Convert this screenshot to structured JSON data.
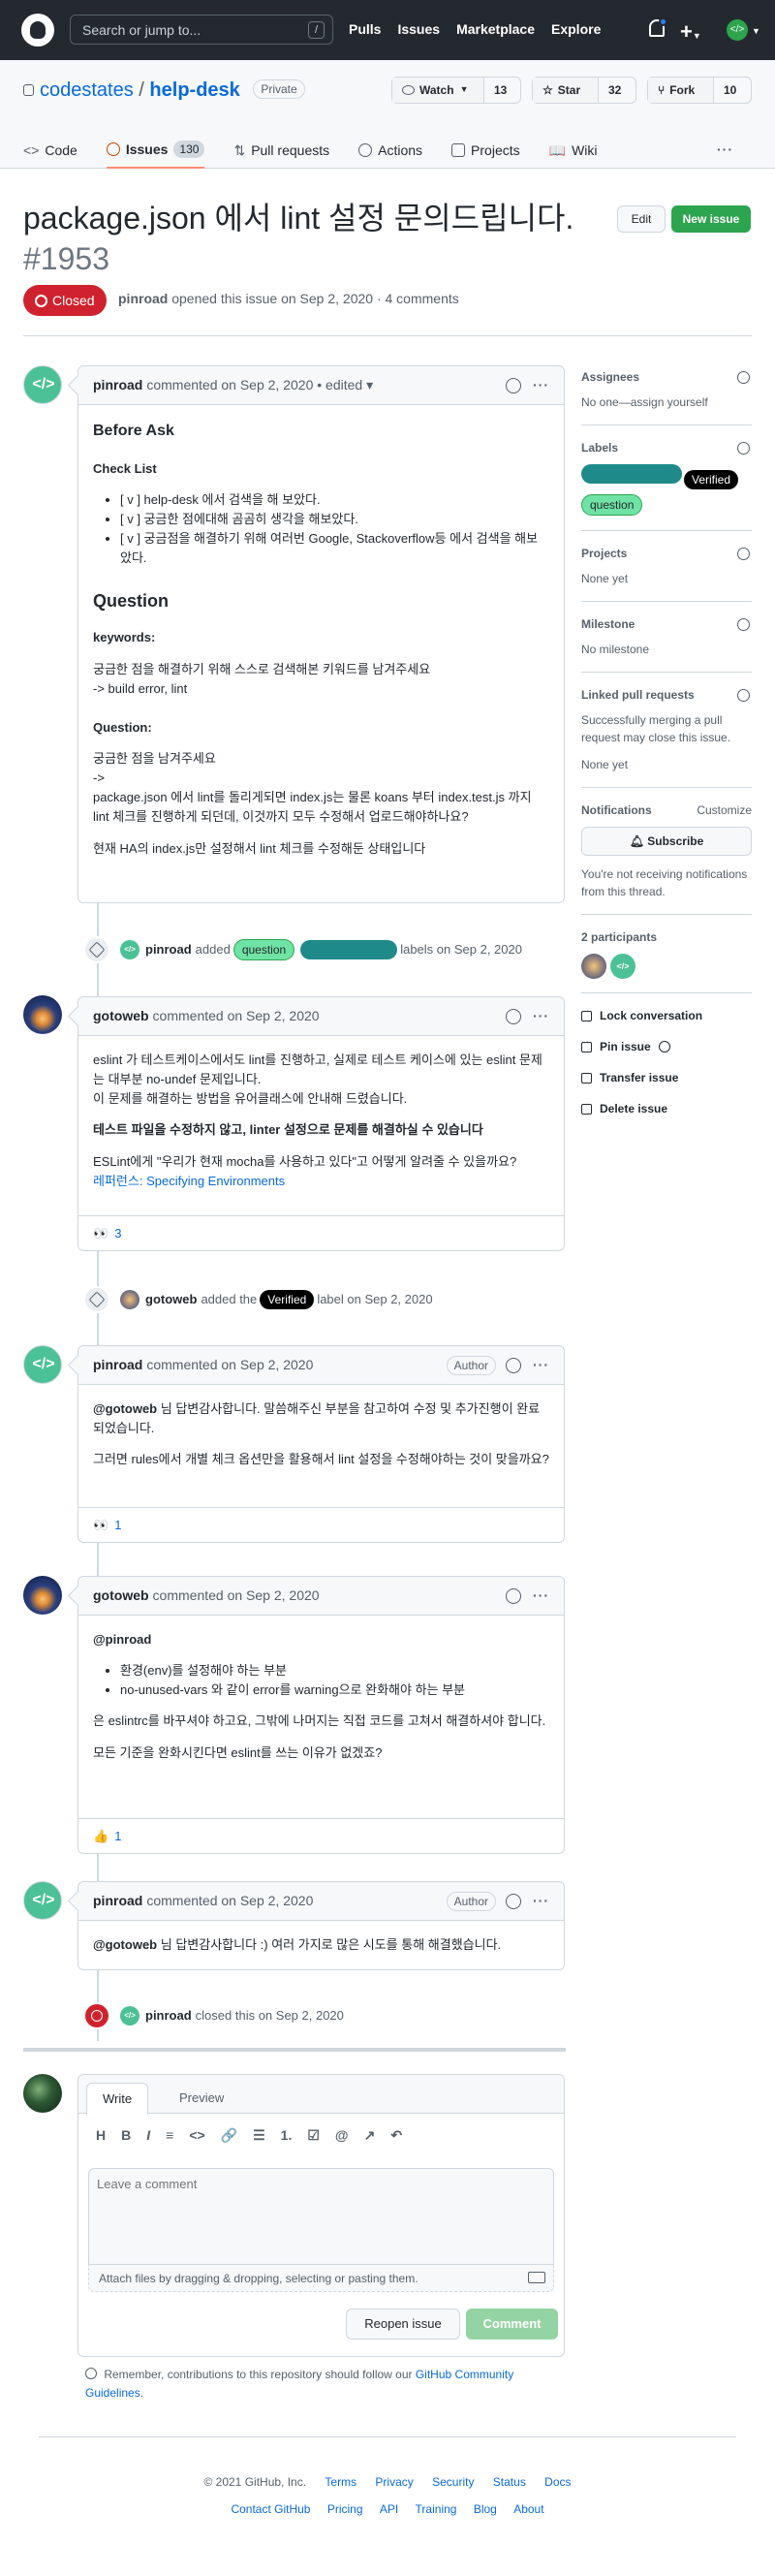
{
  "topbar": {
    "search_placeholder": "Search or jump to...",
    "slash": "/",
    "nav": [
      "Pulls",
      "Issues",
      "Marketplace",
      "Explore"
    ],
    "icons": [
      "github-logo-icon",
      "bell-icon",
      "plus-icon",
      "avatar"
    ]
  },
  "repo": {
    "owner": "codestates",
    "sep": "/",
    "name": "help-desk",
    "visibility": "Private",
    "watch_label": "Watch",
    "watch_count": "13",
    "star_label": "Star",
    "star_count": "32",
    "fork_label": "Fork",
    "fork_count": "10",
    "tabs": [
      {
        "label": "Code"
      },
      {
        "label": "Issues",
        "count": "130"
      },
      {
        "label": "Pull requests"
      },
      {
        "label": "Actions"
      },
      {
        "label": "Projects"
      },
      {
        "label": "Wiki"
      }
    ],
    "more": "···"
  },
  "issue": {
    "title": "package.json 에서 lint 설정 문의드립니다.",
    "number": "#1953",
    "edit_label": "Edit",
    "new_issue_label": "New issue",
    "status": "Closed",
    "author": "pinroad",
    "meta_rest": "opened this issue on Sep 2, 2020 · 4 comments"
  },
  "comments": [
    {
      "author": "pinroad",
      "meta": "commented on Sep 2, 2020 • edited ▾",
      "h_before": "Before Ask",
      "h_check": "Check List",
      "check": [
        "[ v ] help-desk 에서 검색을 해 보았다.",
        "[ v ] 궁금한 점에대해 곰곰히 생각을 해보았다.",
        "[ v ] 궁금점을 해결하기 위해 여러번 Google, Stackoverflow등 에서 검색을 해보았다."
      ],
      "h_question": "Question",
      "h_keywords": "keywords:",
      "keywords_text_1": "궁금한 점을 해결하기 위해 스스로 검색해본 키워드를 남겨주세요",
      "keywords_text_2": "-> build error, lint",
      "h_q": "Question:",
      "q_1": "궁금한 점을 남겨주세요",
      "q_2": "->",
      "q_3": "package.json 에서 lint를 돌리게되면 index.js는 물론 koans 부터 index.test.js 까지 lint 체크를 진행하게 되던데, 이것까지 모두 수정해서 업로드해야하나요?",
      "q_4": "현재 HA의 index.js만 설정해서 lint 체크를 수정해둔 상태입니다"
    },
    {
      "author": "gotoweb",
      "meta": "commented on Sep 2, 2020",
      "p1": "eslint 가 테스트케이스에서도 lint를 진행하고, 실제로 테스트 케이스에 있는 eslint 문제는 대부분 no-undef 문제입니다.",
      "p2": "이 문제를 해결하는 방법을 유어클래스에 안내해 드렸습니다.",
      "p3": "테스트 파일을 수정하지 않고, linter 설정으로 문제를 해결하실 수 있습니다",
      "p4": "ESLint에게 \"우리가 현재 mocha를 사용하고 있다\"고 어떻게 알려줄 수 있을까요?",
      "link": "레퍼런스: Specifying Environments",
      "reaction": "👀",
      "reaction_count": "3"
    },
    {
      "author": "pinroad",
      "meta": "commented on Sep 2, 2020",
      "role": "Author",
      "mention": "@gotoweb",
      "p1": "님 답변감사합니다. 말씀해주신 부분을 참고하여 수정 및 추가진행이 완료되었습니다.",
      "p2": "그러면 rules에서 개별 체크 옵션만을 활용해서 lint 설정을 수정해야하는 것이 맞을까요?",
      "reaction": "👀",
      "reaction_count": "1"
    },
    {
      "author": "gotoweb",
      "meta": "commented on Sep 2, 2020",
      "mention": "@pinroad",
      "li": [
        "환경(env)를 설정해야 하는 부분",
        "no-unused-vars 와 같이 error를 warning으로 완화해야 하는 부분"
      ],
      "p1": "은 eslintrc를 바꾸셔야 하고요, 그밖에 나머지는 직접 코드를 고쳐서 해결하셔야 합니다.",
      "p2": "모든 기준을 완화시킨다면 eslint를 쓰는 이유가 없겠죠?",
      "reaction": "👍",
      "reaction_count": "1"
    },
    {
      "author": "pinroad",
      "meta": "commented on Sep 2, 2020",
      "role": "Author",
      "mention": "@gotoweb",
      "p1": "님 답변감사합니다 :) 여러 가지로 많은 시도를 통해 해결했습니다."
    }
  ],
  "events": {
    "labels_added": {
      "actor": "pinroad",
      "verb": "added",
      "label1": "question",
      "label2": "",
      "tail": "labels on Sep 2, 2020"
    },
    "verified_added": {
      "actor": "gotoweb",
      "verb": "added the",
      "label": "Verified",
      "tail": "label on Sep 2, 2020"
    },
    "closed": {
      "actor": "pinroad",
      "verb": "closed this on Sep 2, 2020"
    }
  },
  "sidebar": {
    "assignees_title": "Assignees",
    "assignees_value": "No one—assign yourself",
    "labels_title": "Labels",
    "labels": [
      {
        "name": "",
        "bg": "#1f8a8a"
      },
      {
        "name": "Verified",
        "bg": "#000000"
      },
      {
        "name": "question",
        "bg": "#6fe3a4"
      }
    ],
    "projects_title": "Projects",
    "projects_value": "None yet",
    "milestone_title": "Milestone",
    "milestone_value": "No milestone",
    "linked_title": "Linked pull requests",
    "linked_desc": "Successfully merging a pull request may close this issue.",
    "linked_value": "None yet",
    "notif_title": "Notifications",
    "notif_customize": "Customize",
    "subscribe": "Subscribe",
    "notif_desc": "You're not receiving notifications from this thread.",
    "participants": "2 participants",
    "actions": [
      "Lock conversation",
      "Pin issue",
      "Transfer issue",
      "Delete issue"
    ]
  },
  "editor": {
    "tab_write": "Write",
    "tab_preview": "Preview",
    "tools": [
      "H",
      "B",
      "I",
      "≡",
      "<>",
      "🔗",
      "☰",
      "1.",
      "☑",
      "@",
      "↗",
      "↶"
    ],
    "placeholder": "Leave a comment",
    "attach": "Attach files by dragging & dropping, selecting or pasting them.",
    "reopen": "Reopen issue",
    "comment": "Comment",
    "remember_pre": "Remember, contributions to this repository should follow our",
    "remember_link": "GitHub Community Guidelines",
    "remember_post": "."
  },
  "footer": {
    "copyright": "© 2021 GitHub, Inc.",
    "row1": [
      "Terms",
      "Privacy",
      "Security",
      "Status",
      "Docs"
    ],
    "row2": [
      "Contact GitHub",
      "Pricing",
      "API",
      "Training",
      "Blog",
      "About"
    ]
  },
  "colors": {
    "accent": "#0969da",
    "closed": "#cf222e",
    "green": "#2da44e",
    "header": "#24292f"
  }
}
